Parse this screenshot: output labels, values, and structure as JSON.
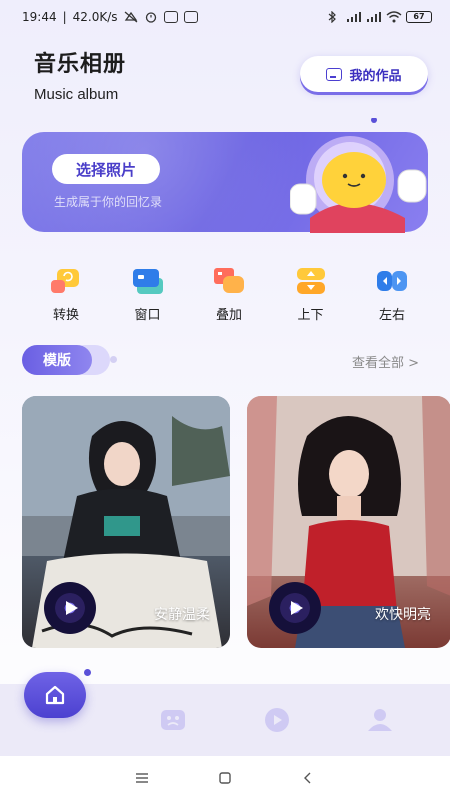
{
  "status_bar": {
    "time": "19:44",
    "speed": "42.0K/s",
    "battery": "67"
  },
  "header": {
    "title": "音乐相册",
    "subtitle": "Music album",
    "my_works_label": "我的作品"
  },
  "banner": {
    "button_label": "选择照片",
    "subtitle": "生成属于你的回忆录"
  },
  "quick_actions": [
    {
      "label": "转换",
      "icon": "convert-icon"
    },
    {
      "label": "窗口",
      "icon": "window-icon"
    },
    {
      "label": "叠加",
      "icon": "overlay-icon"
    },
    {
      "label": "上下",
      "icon": "up-down-icon"
    },
    {
      "label": "左右",
      "icon": "left-right-icon"
    }
  ],
  "templates_section": {
    "tab_label": "模版",
    "view_all": "查看全部 >"
  },
  "template_cards": [
    {
      "title": "安静温柔"
    },
    {
      "title": "欢快明亮"
    }
  ],
  "bottom_nav": [
    {
      "name": "home",
      "icon": "home-icon",
      "active": true
    },
    {
      "name": "album",
      "icon": "album-icon",
      "active": false
    },
    {
      "name": "video",
      "icon": "video-play-icon",
      "active": false
    },
    {
      "name": "profile",
      "icon": "user-icon",
      "active": false
    }
  ],
  "colors": {
    "accent": "#6a5fe3",
    "banner": "#7f7be9",
    "text": "#222222"
  }
}
